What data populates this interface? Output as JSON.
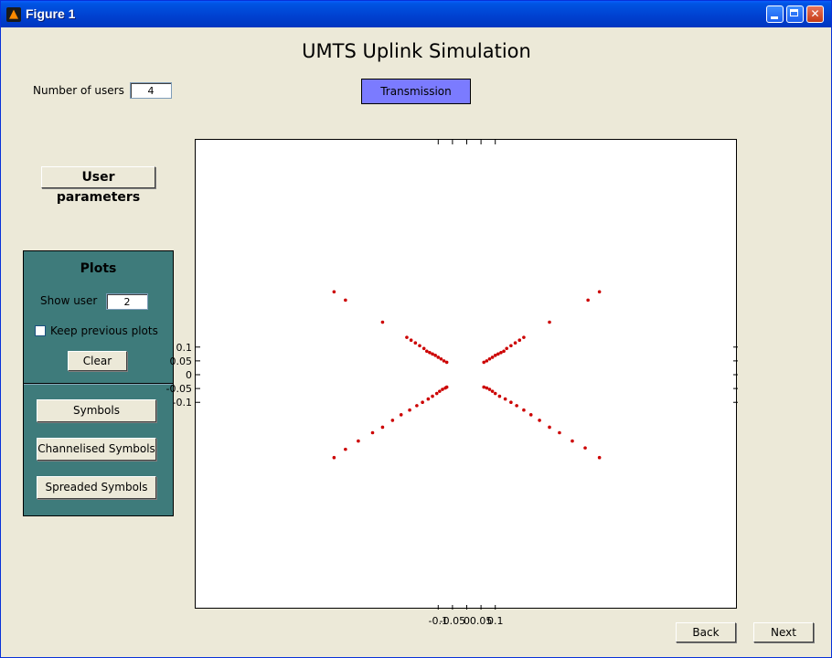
{
  "window": {
    "title": "Figure 1"
  },
  "app": {
    "heading": "UMTS Uplink Simulation",
    "num_users_label": "Number of users",
    "num_users_value": "4",
    "transmission_label": "Transmission",
    "user_params_label": "User parameters"
  },
  "plots_panel": {
    "title": "Plots",
    "show_user_label": "Show user",
    "show_user_value": "2",
    "keep_previous_label": "Keep previous plots",
    "keep_previous_checked": false,
    "clear_label": "Clear",
    "symbols_label": "Symbols",
    "channelised_label": "Channelised Symbols",
    "spreaded_label": "Spreaded Symbols"
  },
  "nav": {
    "back_label": "Back",
    "next_label": "Next"
  },
  "colors": {
    "marker": "#cc0000",
    "panel": "#3e7b7b",
    "transmission": "#7b7bff"
  },
  "chart_data": {
    "type": "scatter",
    "title": "",
    "xlabel": "",
    "ylabel": "",
    "xlim": [
      -0.95,
      0.95
    ],
    "ylim": [
      -0.85,
      0.85
    ],
    "xticks": [
      -0.1,
      -0.05,
      0,
      0.05,
      0.1
    ],
    "xtick_labels": [
      "-0.1",
      "-0.05",
      "0",
      "0.05",
      "0.1"
    ],
    "yticks": [
      0.1,
      0.05,
      0,
      -0.05,
      -0.1
    ],
    "ytick_labels": [
      "0.1",
      "0.05",
      "0",
      "-0.05",
      "-0.1"
    ],
    "series": [
      {
        "values": [
          [
            -0.465,
            0.3
          ],
          [
            -0.425,
            0.27
          ],
          [
            -0.295,
            0.19
          ],
          [
            -0.21,
            0.135
          ],
          [
            -0.195,
            0.125
          ],
          [
            -0.18,
            0.115
          ],
          [
            -0.165,
            0.105
          ],
          [
            -0.15,
            0.095
          ],
          [
            -0.14,
            0.085
          ],
          [
            -0.13,
            0.08
          ],
          [
            -0.12,
            0.075
          ],
          [
            -0.11,
            0.07
          ],
          [
            -0.1,
            0.063
          ],
          [
            -0.09,
            0.057
          ],
          [
            -0.08,
            0.05
          ],
          [
            -0.07,
            0.045
          ],
          [
            0.465,
            0.3
          ],
          [
            0.425,
            0.27
          ],
          [
            0.29,
            0.19
          ],
          [
            0.2,
            0.135
          ],
          [
            0.185,
            0.125
          ],
          [
            0.17,
            0.115
          ],
          [
            0.155,
            0.105
          ],
          [
            0.14,
            0.095
          ],
          [
            0.13,
            0.085
          ],
          [
            0.12,
            0.08
          ],
          [
            0.11,
            0.075
          ],
          [
            0.1,
            0.07
          ],
          [
            0.09,
            0.063
          ],
          [
            0.08,
            0.057
          ],
          [
            0.07,
            0.05
          ],
          [
            0.06,
            0.045
          ],
          [
            -0.465,
            -0.3
          ],
          [
            -0.425,
            -0.27
          ],
          [
            -0.38,
            -0.24
          ],
          [
            -0.33,
            -0.21
          ],
          [
            -0.295,
            -0.19
          ],
          [
            -0.26,
            -0.165
          ],
          [
            -0.23,
            -0.145
          ],
          [
            -0.2,
            -0.128
          ],
          [
            -0.175,
            -0.112
          ],
          [
            -0.155,
            -0.1
          ],
          [
            -0.135,
            -0.088
          ],
          [
            -0.12,
            -0.078
          ],
          [
            -0.105,
            -0.068
          ],
          [
            -0.095,
            -0.06
          ],
          [
            -0.085,
            -0.053
          ],
          [
            -0.075,
            -0.048
          ],
          [
            -0.07,
            -0.045
          ],
          [
            0.465,
            -0.3
          ],
          [
            0.415,
            -0.265
          ],
          [
            0.37,
            -0.24
          ],
          [
            0.325,
            -0.21
          ],
          [
            0.29,
            -0.19
          ],
          [
            0.255,
            -0.165
          ],
          [
            0.225,
            -0.145
          ],
          [
            0.2,
            -0.128
          ],
          [
            0.175,
            -0.112
          ],
          [
            0.155,
            -0.1
          ],
          [
            0.135,
            -0.088
          ],
          [
            0.115,
            -0.078
          ],
          [
            0.1,
            -0.068
          ],
          [
            0.09,
            -0.06
          ],
          [
            0.08,
            -0.053
          ],
          [
            0.07,
            -0.048
          ],
          [
            0.06,
            -0.045
          ]
        ]
      }
    ]
  }
}
